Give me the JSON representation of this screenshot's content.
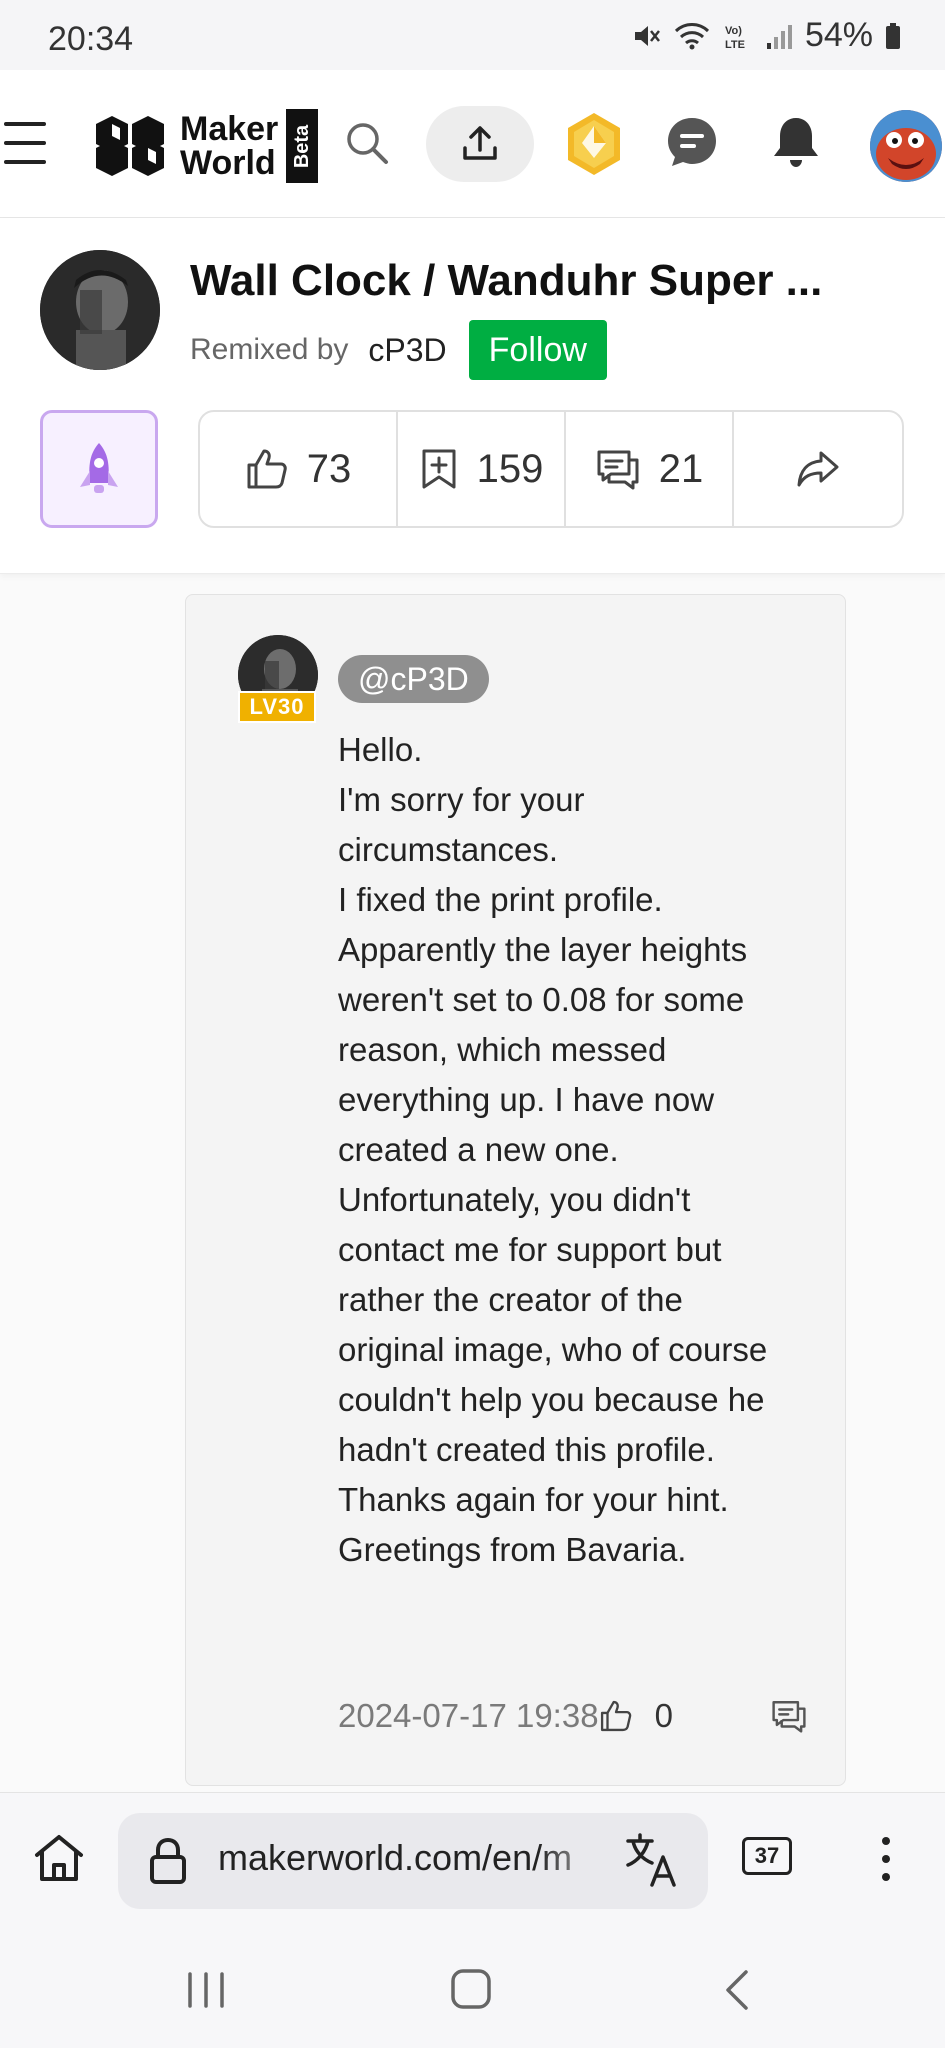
{
  "status_bar": {
    "time": "20:34",
    "battery": "54%",
    "icons": [
      "mute-icon",
      "wifi-icon",
      "volte-icon",
      "signal-icon",
      "battery-icon"
    ]
  },
  "nav": {
    "logo_line1": "Maker",
    "logo_line2": "World",
    "logo_badge": "Beta",
    "icons": [
      "menu-icon",
      "search-icon",
      "upload-icon",
      "coin-icon",
      "message-icon",
      "bell-icon",
      "user-avatar"
    ]
  },
  "model": {
    "title": "Wall Clock / Wanduhr Super ...",
    "remixed_by_label": "Remixed by",
    "author": "cP3D",
    "follow_label": "Follow",
    "stats": {
      "likes": "73",
      "collects": "159",
      "comments": "21"
    }
  },
  "comment": {
    "mention": "@cP3D",
    "level": "LV30",
    "body": [
      "Hello.",
      "I'm sorry for your circumstances.",
      "I fixed the print profile. Apparently the layer heights weren't set to 0.08 for some reason, which messed everything up. I have now created a new one. Unfortunately, you didn't contact me for support but rather the creator of the original image, who of course couldn't help you because he hadn't created this profile. Thanks again for your hint. Greetings from Bavaria."
    ],
    "date": "2024-07-17 19:38",
    "likes": "0"
  },
  "browser": {
    "url": "makerworld.com/en/m",
    "tabs_count": "37"
  },
  "colors": {
    "follow_green": "#00ae42",
    "boost_purple": "#a46ae6",
    "level_gold": "#f0b100"
  }
}
